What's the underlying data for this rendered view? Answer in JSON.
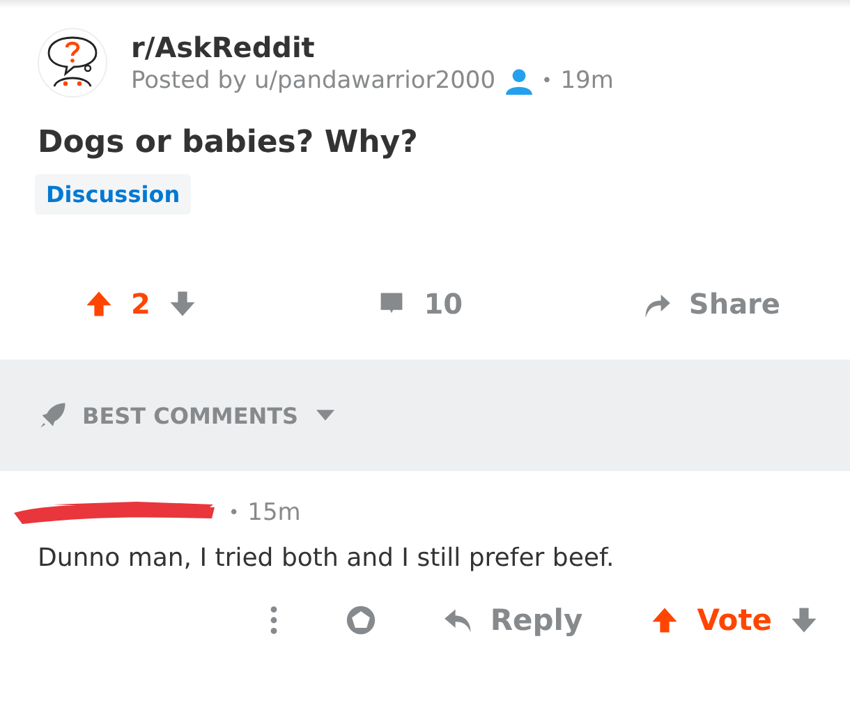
{
  "post": {
    "subreddit": "r/AskReddit",
    "posted_by": "Posted by u/pandawarrior2000",
    "separator": "•",
    "age": "19m",
    "title": "Dogs or babies? Why?",
    "flair": "Discussion",
    "upvoted": true,
    "score": "2",
    "comments": "10",
    "share": "Share"
  },
  "sort": {
    "label": "BEST COMMENTS"
  },
  "comments": [
    {
      "author_redacted": true,
      "separator": "•",
      "age": "15m",
      "body": "Dunno man, I tried both and I still prefer beef.",
      "reply": "Reply",
      "vote_label": "Vote",
      "upvoted": true
    }
  ]
}
